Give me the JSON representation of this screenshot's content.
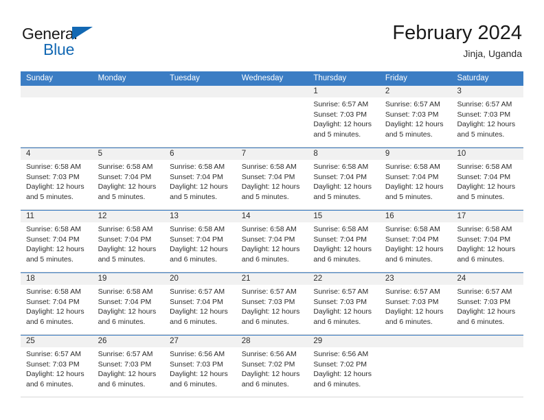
{
  "brand": {
    "name_top": "General",
    "name_bottom": "Blue",
    "triangle_icon": "blue-triangle-icon",
    "color_black": "#1a1a1a",
    "color_blue": "#1268b3"
  },
  "header": {
    "title": "February 2024",
    "subtitle": "Jinja, Uganda"
  },
  "calendar": {
    "accent_color": "#3b7dc4",
    "number_band_color": "#f1f1f1",
    "weekdays": [
      "Sunday",
      "Monday",
      "Tuesday",
      "Wednesday",
      "Thursday",
      "Friday",
      "Saturday"
    ],
    "weeks": [
      [
        {
          "day": "",
          "lines": []
        },
        {
          "day": "",
          "lines": []
        },
        {
          "day": "",
          "lines": []
        },
        {
          "day": "",
          "lines": []
        },
        {
          "day": "1",
          "lines": [
            "Sunrise: 6:57 AM",
            "Sunset: 7:03 PM",
            "Daylight: 12 hours",
            "and 5 minutes."
          ]
        },
        {
          "day": "2",
          "lines": [
            "Sunrise: 6:57 AM",
            "Sunset: 7:03 PM",
            "Daylight: 12 hours",
            "and 5 minutes."
          ]
        },
        {
          "day": "3",
          "lines": [
            "Sunrise: 6:57 AM",
            "Sunset: 7:03 PM",
            "Daylight: 12 hours",
            "and 5 minutes."
          ]
        }
      ],
      [
        {
          "day": "4",
          "lines": [
            "Sunrise: 6:58 AM",
            "Sunset: 7:03 PM",
            "Daylight: 12 hours",
            "and 5 minutes."
          ]
        },
        {
          "day": "5",
          "lines": [
            "Sunrise: 6:58 AM",
            "Sunset: 7:04 PM",
            "Daylight: 12 hours",
            "and 5 minutes."
          ]
        },
        {
          "day": "6",
          "lines": [
            "Sunrise: 6:58 AM",
            "Sunset: 7:04 PM",
            "Daylight: 12 hours",
            "and 5 minutes."
          ]
        },
        {
          "day": "7",
          "lines": [
            "Sunrise: 6:58 AM",
            "Sunset: 7:04 PM",
            "Daylight: 12 hours",
            "and 5 minutes."
          ]
        },
        {
          "day": "8",
          "lines": [
            "Sunrise: 6:58 AM",
            "Sunset: 7:04 PM",
            "Daylight: 12 hours",
            "and 5 minutes."
          ]
        },
        {
          "day": "9",
          "lines": [
            "Sunrise: 6:58 AM",
            "Sunset: 7:04 PM",
            "Daylight: 12 hours",
            "and 5 minutes."
          ]
        },
        {
          "day": "10",
          "lines": [
            "Sunrise: 6:58 AM",
            "Sunset: 7:04 PM",
            "Daylight: 12 hours",
            "and 5 minutes."
          ]
        }
      ],
      [
        {
          "day": "11",
          "lines": [
            "Sunrise: 6:58 AM",
            "Sunset: 7:04 PM",
            "Daylight: 12 hours",
            "and 5 minutes."
          ]
        },
        {
          "day": "12",
          "lines": [
            "Sunrise: 6:58 AM",
            "Sunset: 7:04 PM",
            "Daylight: 12 hours",
            "and 5 minutes."
          ]
        },
        {
          "day": "13",
          "lines": [
            "Sunrise: 6:58 AM",
            "Sunset: 7:04 PM",
            "Daylight: 12 hours",
            "and 6 minutes."
          ]
        },
        {
          "day": "14",
          "lines": [
            "Sunrise: 6:58 AM",
            "Sunset: 7:04 PM",
            "Daylight: 12 hours",
            "and 6 minutes."
          ]
        },
        {
          "day": "15",
          "lines": [
            "Sunrise: 6:58 AM",
            "Sunset: 7:04 PM",
            "Daylight: 12 hours",
            "and 6 minutes."
          ]
        },
        {
          "day": "16",
          "lines": [
            "Sunrise: 6:58 AM",
            "Sunset: 7:04 PM",
            "Daylight: 12 hours",
            "and 6 minutes."
          ]
        },
        {
          "day": "17",
          "lines": [
            "Sunrise: 6:58 AM",
            "Sunset: 7:04 PM",
            "Daylight: 12 hours",
            "and 6 minutes."
          ]
        }
      ],
      [
        {
          "day": "18",
          "lines": [
            "Sunrise: 6:58 AM",
            "Sunset: 7:04 PM",
            "Daylight: 12 hours",
            "and 6 minutes."
          ]
        },
        {
          "day": "19",
          "lines": [
            "Sunrise: 6:58 AM",
            "Sunset: 7:04 PM",
            "Daylight: 12 hours",
            "and 6 minutes."
          ]
        },
        {
          "day": "20",
          "lines": [
            "Sunrise: 6:57 AM",
            "Sunset: 7:04 PM",
            "Daylight: 12 hours",
            "and 6 minutes."
          ]
        },
        {
          "day": "21",
          "lines": [
            "Sunrise: 6:57 AM",
            "Sunset: 7:03 PM",
            "Daylight: 12 hours",
            "and 6 minutes."
          ]
        },
        {
          "day": "22",
          "lines": [
            "Sunrise: 6:57 AM",
            "Sunset: 7:03 PM",
            "Daylight: 12 hours",
            "and 6 minutes."
          ]
        },
        {
          "day": "23",
          "lines": [
            "Sunrise: 6:57 AM",
            "Sunset: 7:03 PM",
            "Daylight: 12 hours",
            "and 6 minutes."
          ]
        },
        {
          "day": "24",
          "lines": [
            "Sunrise: 6:57 AM",
            "Sunset: 7:03 PM",
            "Daylight: 12 hours",
            "and 6 minutes."
          ]
        }
      ],
      [
        {
          "day": "25",
          "lines": [
            "Sunrise: 6:57 AM",
            "Sunset: 7:03 PM",
            "Daylight: 12 hours",
            "and 6 minutes."
          ]
        },
        {
          "day": "26",
          "lines": [
            "Sunrise: 6:57 AM",
            "Sunset: 7:03 PM",
            "Daylight: 12 hours",
            "and 6 minutes."
          ]
        },
        {
          "day": "27",
          "lines": [
            "Sunrise: 6:56 AM",
            "Sunset: 7:03 PM",
            "Daylight: 12 hours",
            "and 6 minutes."
          ]
        },
        {
          "day": "28",
          "lines": [
            "Sunrise: 6:56 AM",
            "Sunset: 7:02 PM",
            "Daylight: 12 hours",
            "and 6 minutes."
          ]
        },
        {
          "day": "29",
          "lines": [
            "Sunrise: 6:56 AM",
            "Sunset: 7:02 PM",
            "Daylight: 12 hours",
            "and 6 minutes."
          ]
        },
        {
          "day": "",
          "lines": []
        },
        {
          "day": "",
          "lines": []
        }
      ]
    ]
  }
}
